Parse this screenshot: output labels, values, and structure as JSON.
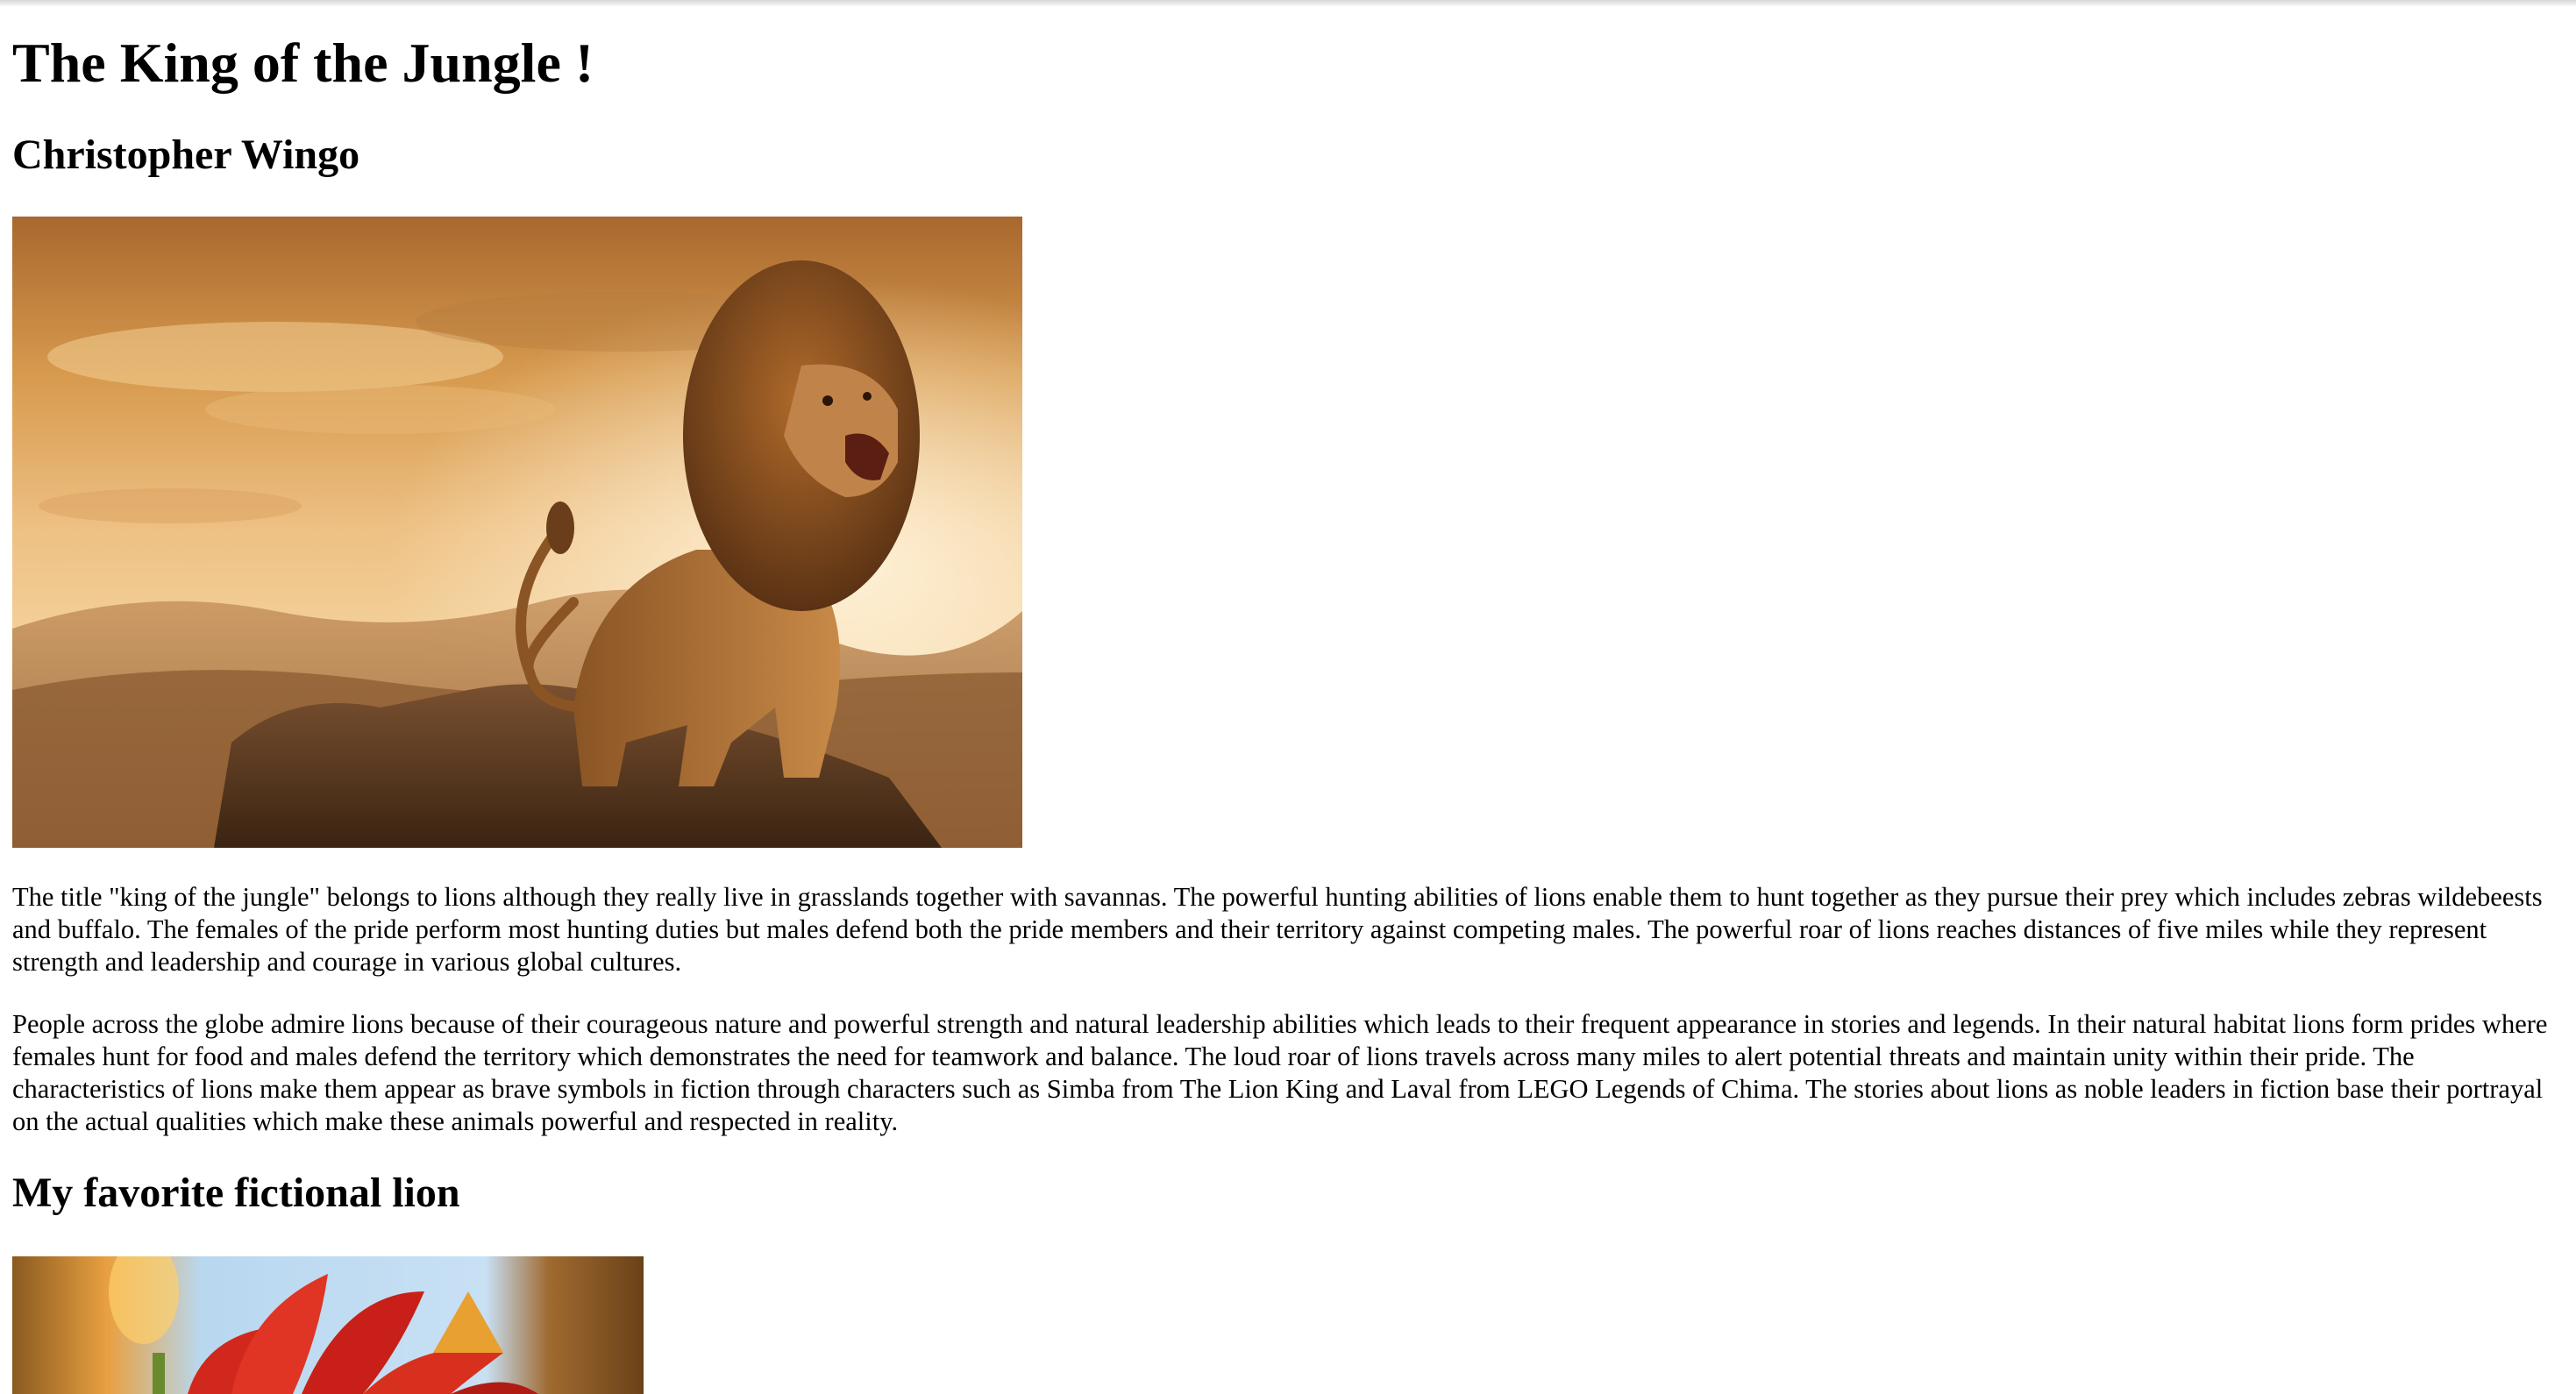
{
  "page": {
    "title": "The King of the Jungle !",
    "author": "Christopher Wingo",
    "paragraphs": [
      "The title \"king of the jungle\" belongs to lions although they really live in grasslands together with savannas. The powerful hunting abilities of lions enable them to hunt together as they pursue their prey which includes zebras wildebeests and buffalo. The females of the pride perform most hunting duties but males defend both the pride members and their territory against competing males. The powerful roar of lions reaches distances of five miles while they represent strength and leadership and courage in various global cultures.",
      "People across the globe admire lions because of their courageous nature and powerful strength and natural leadership abilities which leads to their frequent appearance in stories and legends. In their natural habitat lions form prides where females hunt for food and males defend the territory which demonstrates the need for teamwork and balance. The loud roar of lions travels across many miles to alert potential threats and maintain unity within their pride. The characteristics of lions make them appear as brave symbols in fiction through characters such as Simba from The Lion King and Laval from LEGO Legends of Chima. The stories about lions as noble leaders in fiction base their portrayal on the actual qualities which make these animals powerful and respected in reality."
    ],
    "favorite_heading": "My favorite fictional lion"
  },
  "images": {
    "hero": "roaring-lion-on-rock-at-sunset",
    "favorite": "lego-lion-character-laval"
  },
  "colors": {
    "background": "#ffffff",
    "text": "#000000"
  }
}
